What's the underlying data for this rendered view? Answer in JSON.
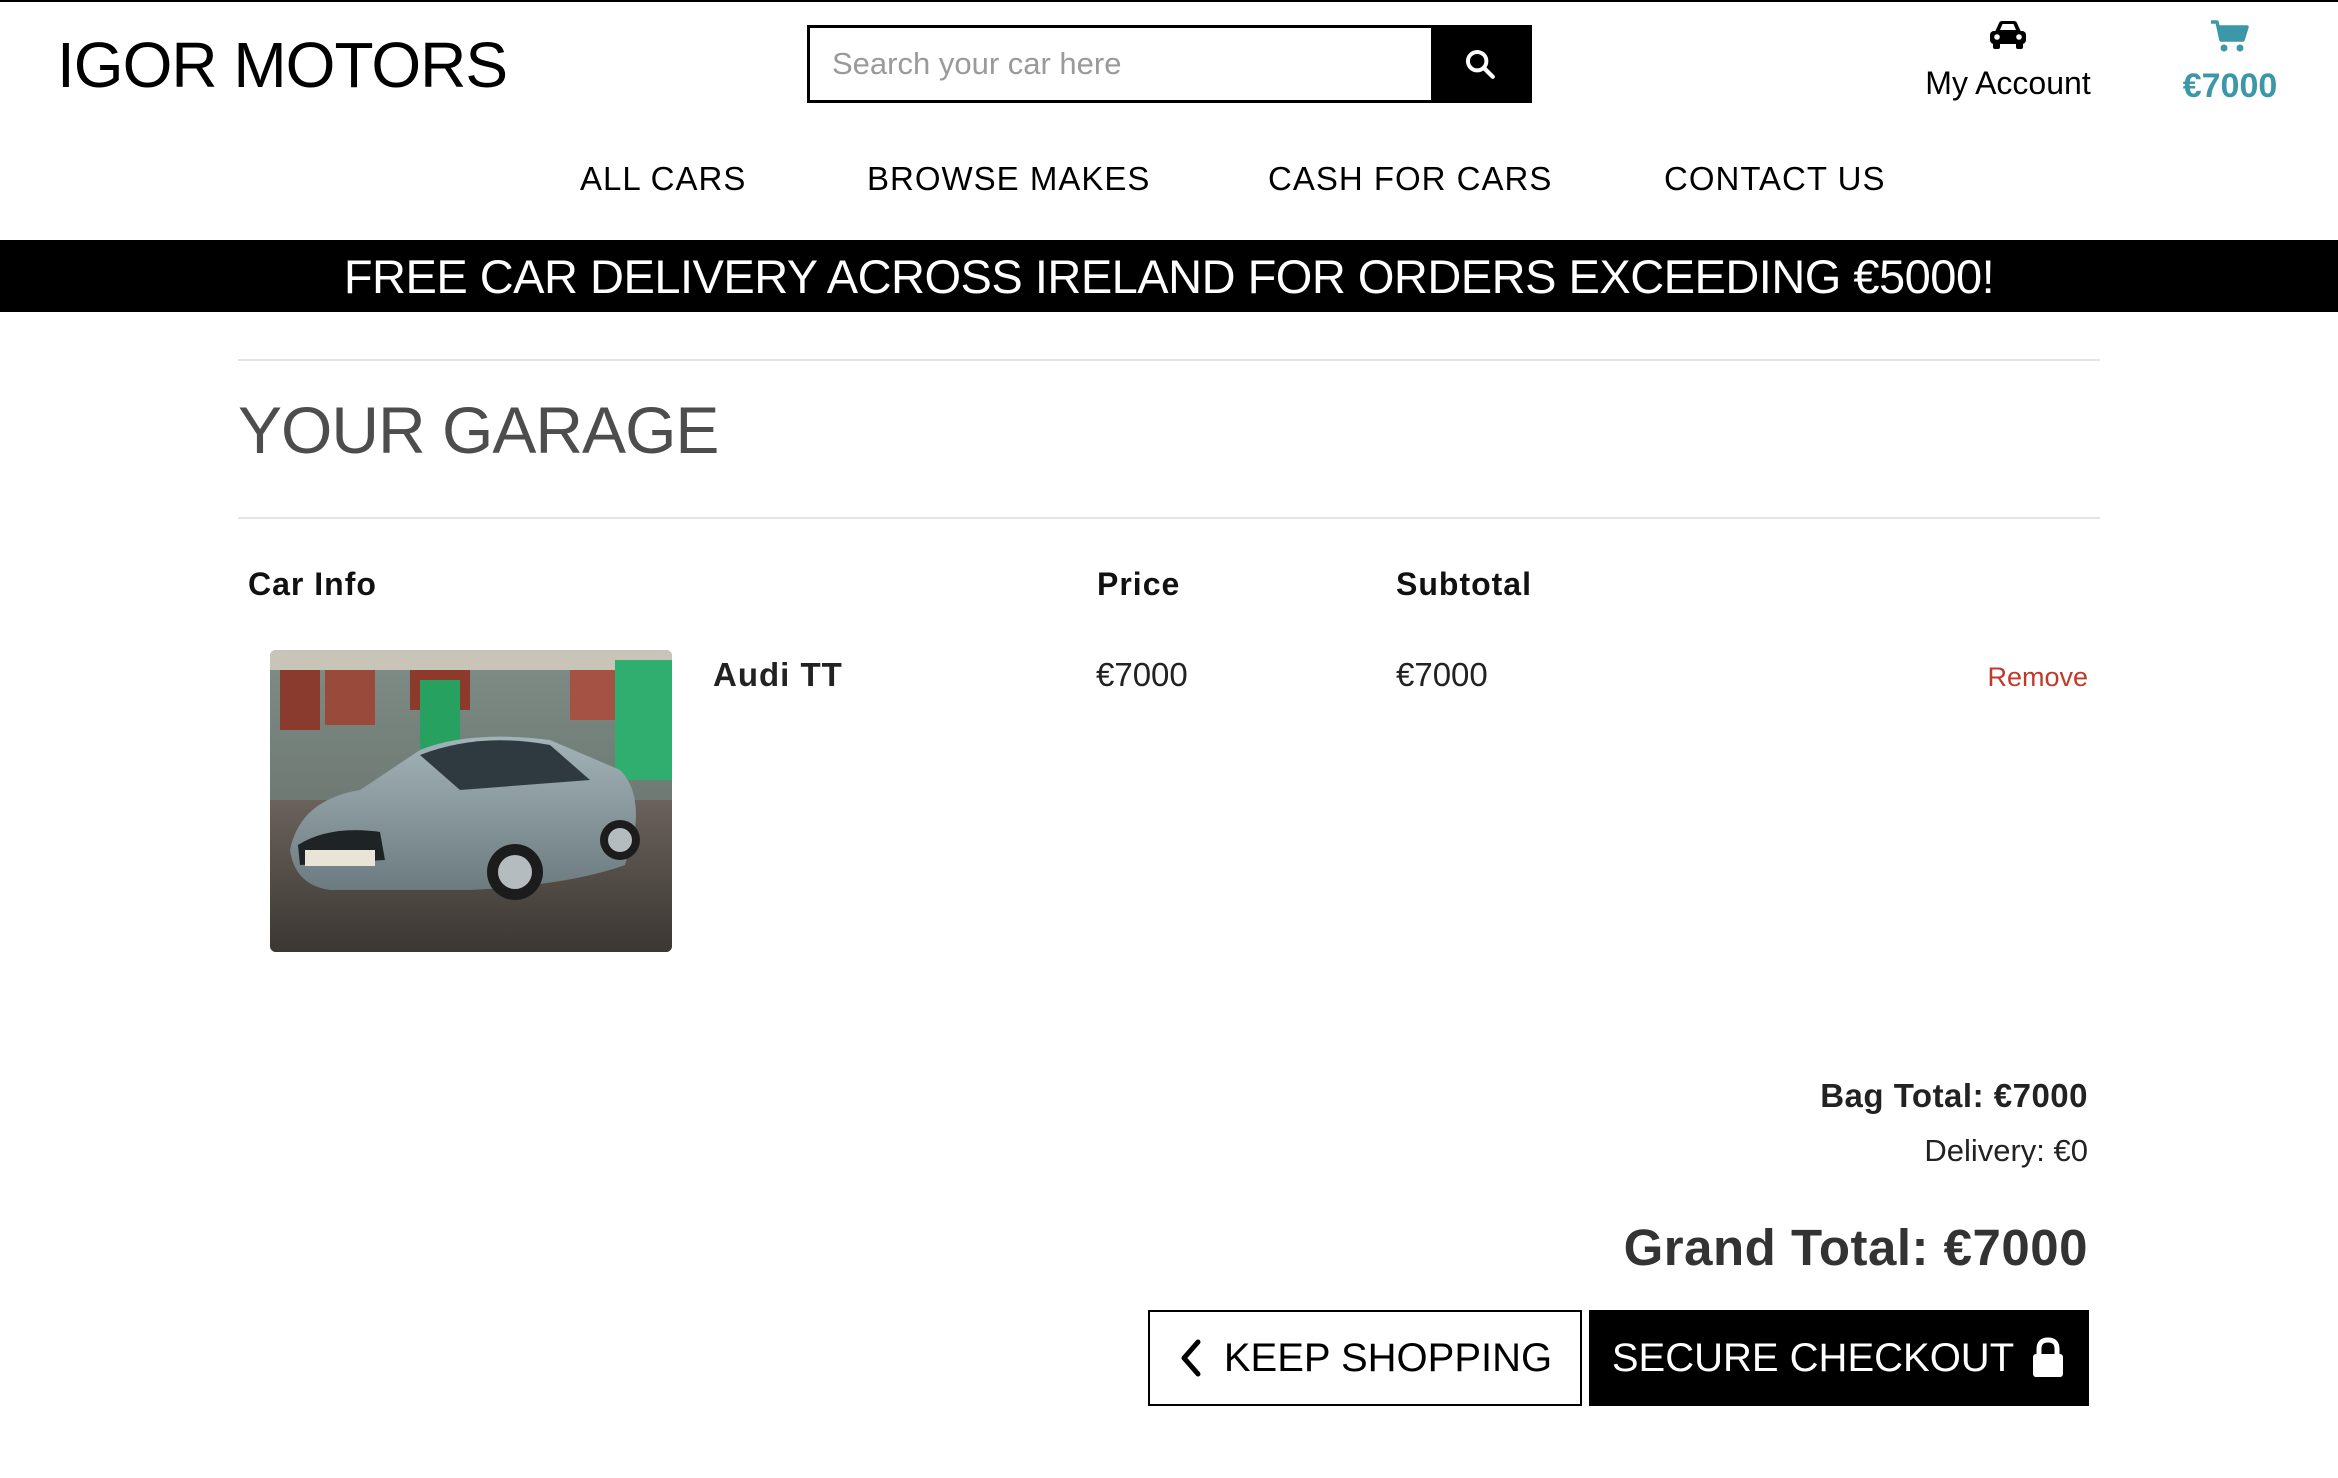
{
  "header": {
    "brand": "IGOR MOTORS",
    "search": {
      "placeholder": "Search your car here"
    },
    "account_label": "My Account",
    "bag_total": "€7000"
  },
  "nav": {
    "items": [
      {
        "label": "ALL CARS"
      },
      {
        "label": "BROWSE MAKES"
      },
      {
        "label": "CASH FOR CARS"
      },
      {
        "label": "CONTACT US"
      }
    ]
  },
  "banner": "FREE CAR DELIVERY ACROSS IRELAND FOR ORDERS EXCEEDING €5000!",
  "garage": {
    "title": "YOUR GARAGE",
    "columns": {
      "info": "Car Info",
      "price": "Price",
      "subtotal": "Subtotal"
    },
    "items": [
      {
        "name": "Audi TT",
        "price": "€7000",
        "subtotal": "€7000",
        "remove": "Remove"
      }
    ]
  },
  "summary": {
    "bag_total": "Bag Total: €7000",
    "delivery": "Delivery: €0",
    "grand_total": "Grand Total: €7000"
  },
  "buttons": {
    "keep_shopping": "KEEP SHOPPING",
    "checkout": "SECURE CHECKOUT"
  },
  "colors": {
    "accent": "#3c97a8",
    "remove": "#c0392b",
    "banner_bg": "#000000"
  }
}
